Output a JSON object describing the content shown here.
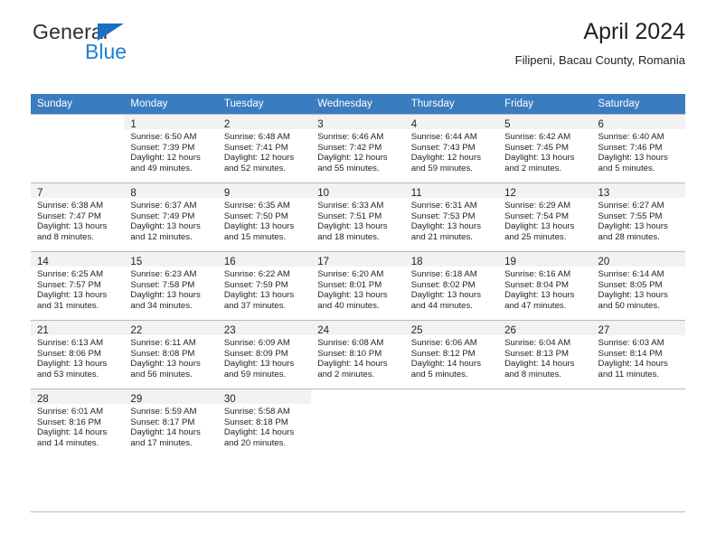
{
  "brand": {
    "name_top": "General",
    "name_bottom": "Blue",
    "triangle_icon": "blue-triangle-logo-icon",
    "color_top": "#2f2f2f",
    "color_bottom": "#1a7fd4"
  },
  "header": {
    "title": "April 2024",
    "location": "Filipeni, Bacau County, Romania"
  },
  "theme": {
    "header_row_bg": "#3a7cc0",
    "header_row_text": "#ffffff",
    "daynum_bar_bg": "#f2f2f2",
    "grid_line": "#b9b9b9",
    "body_text": "#231f20"
  },
  "calendar": {
    "weekdays": [
      "Sunday",
      "Monday",
      "Tuesday",
      "Wednesday",
      "Thursday",
      "Friday",
      "Saturday"
    ],
    "weeks": [
      [
        {
          "day": "",
          "sunrise": "",
          "sunset": "",
          "daylight_line1": "",
          "daylight_line2": ""
        },
        {
          "day": "1",
          "sunrise": "Sunrise: 6:50 AM",
          "sunset": "Sunset: 7:39 PM",
          "daylight_line1": "Daylight: 12 hours",
          "daylight_line2": "and 49 minutes."
        },
        {
          "day": "2",
          "sunrise": "Sunrise: 6:48 AM",
          "sunset": "Sunset: 7:41 PM",
          "daylight_line1": "Daylight: 12 hours",
          "daylight_line2": "and 52 minutes."
        },
        {
          "day": "3",
          "sunrise": "Sunrise: 6:46 AM",
          "sunset": "Sunset: 7:42 PM",
          "daylight_line1": "Daylight: 12 hours",
          "daylight_line2": "and 55 minutes."
        },
        {
          "day": "4",
          "sunrise": "Sunrise: 6:44 AM",
          "sunset": "Sunset: 7:43 PM",
          "daylight_line1": "Daylight: 12 hours",
          "daylight_line2": "and 59 minutes."
        },
        {
          "day": "5",
          "sunrise": "Sunrise: 6:42 AM",
          "sunset": "Sunset: 7:45 PM",
          "daylight_line1": "Daylight: 13 hours",
          "daylight_line2": "and 2 minutes."
        },
        {
          "day": "6",
          "sunrise": "Sunrise: 6:40 AM",
          "sunset": "Sunset: 7:46 PM",
          "daylight_line1": "Daylight: 13 hours",
          "daylight_line2": "and 5 minutes."
        }
      ],
      [
        {
          "day": "7",
          "sunrise": "Sunrise: 6:38 AM",
          "sunset": "Sunset: 7:47 PM",
          "daylight_line1": "Daylight: 13 hours",
          "daylight_line2": "and 8 minutes."
        },
        {
          "day": "8",
          "sunrise": "Sunrise: 6:37 AM",
          "sunset": "Sunset: 7:49 PM",
          "daylight_line1": "Daylight: 13 hours",
          "daylight_line2": "and 12 minutes."
        },
        {
          "day": "9",
          "sunrise": "Sunrise: 6:35 AM",
          "sunset": "Sunset: 7:50 PM",
          "daylight_line1": "Daylight: 13 hours",
          "daylight_line2": "and 15 minutes."
        },
        {
          "day": "10",
          "sunrise": "Sunrise: 6:33 AM",
          "sunset": "Sunset: 7:51 PM",
          "daylight_line1": "Daylight: 13 hours",
          "daylight_line2": "and 18 minutes."
        },
        {
          "day": "11",
          "sunrise": "Sunrise: 6:31 AM",
          "sunset": "Sunset: 7:53 PM",
          "daylight_line1": "Daylight: 13 hours",
          "daylight_line2": "and 21 minutes."
        },
        {
          "day": "12",
          "sunrise": "Sunrise: 6:29 AM",
          "sunset": "Sunset: 7:54 PM",
          "daylight_line1": "Daylight: 13 hours",
          "daylight_line2": "and 25 minutes."
        },
        {
          "day": "13",
          "sunrise": "Sunrise: 6:27 AM",
          "sunset": "Sunset: 7:55 PM",
          "daylight_line1": "Daylight: 13 hours",
          "daylight_line2": "and 28 minutes."
        }
      ],
      [
        {
          "day": "14",
          "sunrise": "Sunrise: 6:25 AM",
          "sunset": "Sunset: 7:57 PM",
          "daylight_line1": "Daylight: 13 hours",
          "daylight_line2": "and 31 minutes."
        },
        {
          "day": "15",
          "sunrise": "Sunrise: 6:23 AM",
          "sunset": "Sunset: 7:58 PM",
          "daylight_line1": "Daylight: 13 hours",
          "daylight_line2": "and 34 minutes."
        },
        {
          "day": "16",
          "sunrise": "Sunrise: 6:22 AM",
          "sunset": "Sunset: 7:59 PM",
          "daylight_line1": "Daylight: 13 hours",
          "daylight_line2": "and 37 minutes."
        },
        {
          "day": "17",
          "sunrise": "Sunrise: 6:20 AM",
          "sunset": "Sunset: 8:01 PM",
          "daylight_line1": "Daylight: 13 hours",
          "daylight_line2": "and 40 minutes."
        },
        {
          "day": "18",
          "sunrise": "Sunrise: 6:18 AM",
          "sunset": "Sunset: 8:02 PM",
          "daylight_line1": "Daylight: 13 hours",
          "daylight_line2": "and 44 minutes."
        },
        {
          "day": "19",
          "sunrise": "Sunrise: 6:16 AM",
          "sunset": "Sunset: 8:04 PM",
          "daylight_line1": "Daylight: 13 hours",
          "daylight_line2": "and 47 minutes."
        },
        {
          "day": "20",
          "sunrise": "Sunrise: 6:14 AM",
          "sunset": "Sunset: 8:05 PM",
          "daylight_line1": "Daylight: 13 hours",
          "daylight_line2": "and 50 minutes."
        }
      ],
      [
        {
          "day": "21",
          "sunrise": "Sunrise: 6:13 AM",
          "sunset": "Sunset: 8:06 PM",
          "daylight_line1": "Daylight: 13 hours",
          "daylight_line2": "and 53 minutes."
        },
        {
          "day": "22",
          "sunrise": "Sunrise: 6:11 AM",
          "sunset": "Sunset: 8:08 PM",
          "daylight_line1": "Daylight: 13 hours",
          "daylight_line2": "and 56 minutes."
        },
        {
          "day": "23",
          "sunrise": "Sunrise: 6:09 AM",
          "sunset": "Sunset: 8:09 PM",
          "daylight_line1": "Daylight: 13 hours",
          "daylight_line2": "and 59 minutes."
        },
        {
          "day": "24",
          "sunrise": "Sunrise: 6:08 AM",
          "sunset": "Sunset: 8:10 PM",
          "daylight_line1": "Daylight: 14 hours",
          "daylight_line2": "and 2 minutes."
        },
        {
          "day": "25",
          "sunrise": "Sunrise: 6:06 AM",
          "sunset": "Sunset: 8:12 PM",
          "daylight_line1": "Daylight: 14 hours",
          "daylight_line2": "and 5 minutes."
        },
        {
          "day": "26",
          "sunrise": "Sunrise: 6:04 AM",
          "sunset": "Sunset: 8:13 PM",
          "daylight_line1": "Daylight: 14 hours",
          "daylight_line2": "and 8 minutes."
        },
        {
          "day": "27",
          "sunrise": "Sunrise: 6:03 AM",
          "sunset": "Sunset: 8:14 PM",
          "daylight_line1": "Daylight: 14 hours",
          "daylight_line2": "and 11 minutes."
        }
      ],
      [
        {
          "day": "28",
          "sunrise": "Sunrise: 6:01 AM",
          "sunset": "Sunset: 8:16 PM",
          "daylight_line1": "Daylight: 14 hours",
          "daylight_line2": "and 14 minutes."
        },
        {
          "day": "29",
          "sunrise": "Sunrise: 5:59 AM",
          "sunset": "Sunset: 8:17 PM",
          "daylight_line1": "Daylight: 14 hours",
          "daylight_line2": "and 17 minutes."
        },
        {
          "day": "30",
          "sunrise": "Sunrise: 5:58 AM",
          "sunset": "Sunset: 8:18 PM",
          "daylight_line1": "Daylight: 14 hours",
          "daylight_line2": "and 20 minutes."
        },
        {
          "day": "",
          "sunrise": "",
          "sunset": "",
          "daylight_line1": "",
          "daylight_line2": ""
        },
        {
          "day": "",
          "sunrise": "",
          "sunset": "",
          "daylight_line1": "",
          "daylight_line2": ""
        },
        {
          "day": "",
          "sunrise": "",
          "sunset": "",
          "daylight_line1": "",
          "daylight_line2": ""
        },
        {
          "day": "",
          "sunrise": "",
          "sunset": "",
          "daylight_line1": "",
          "daylight_line2": ""
        }
      ]
    ]
  }
}
